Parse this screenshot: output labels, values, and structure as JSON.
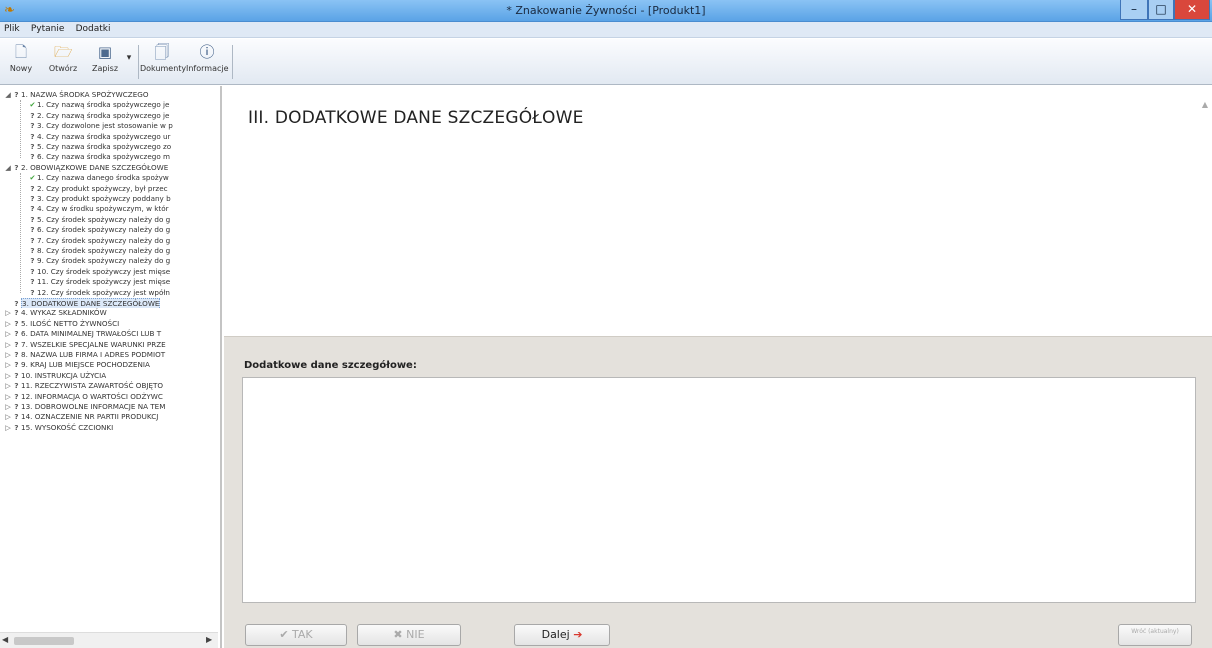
{
  "window": {
    "title": "* Znakowanie Żywności - [Produkt1]",
    "app_icon": "food-labeling-app-icon",
    "minimize": "–",
    "maximize": "□",
    "close": "✕"
  },
  "menu": [
    "Plik",
    "Pytanie",
    "Dodatki"
  ],
  "toolbar": {
    "new": {
      "label": "Nowy",
      "icon": "new-document-icon"
    },
    "open": {
      "label": "Otwórz",
      "icon": "open-folder-icon"
    },
    "save": {
      "label": "Zapisz",
      "icon": "save-disk-icon"
    },
    "save_dropdown": "▾",
    "documents": {
      "label": "Dokumenty",
      "icon": "documents-icon"
    },
    "info": {
      "label": "Informacje",
      "icon": "info-icon"
    }
  },
  "tree": [
    {
      "label": "1. NAZWA ŚRODKA SPOŻYWCZEGO",
      "expander": "◢",
      "status": "?",
      "children": [
        {
          "label": "1. Czy nazwą środka spożywczego je",
          "status": "✔"
        },
        {
          "label": "2. Czy nazwą środka spożywczego je",
          "status": "?"
        },
        {
          "label": "3. Czy dozwolone jest stosowanie w p",
          "status": "?"
        },
        {
          "label": "4. Czy nazwa środka spożywczego ur",
          "status": "?"
        },
        {
          "label": "5. Czy nazwa środka spożywczego zo",
          "status": "?"
        },
        {
          "label": "6. Czy nazwa środka spożywczego m",
          "status": "?"
        }
      ]
    },
    {
      "label": "2. OBOWIĄZKOWE DANE SZCZEGÓŁOWE",
      "expander": "◢",
      "status": "?",
      "children": [
        {
          "label": "1. Czy nazwa danego środka spożyw",
          "status": "✔"
        },
        {
          "label": "2. Czy produkt spożywczy, był przec",
          "status": "?"
        },
        {
          "label": "3. Czy produkt spożywczy poddany b",
          "status": "?"
        },
        {
          "label": "4. Czy w środku spożywczym, w któr",
          "status": "?"
        },
        {
          "label": "5. Czy środek spożywczy należy do g",
          "status": "?"
        },
        {
          "label": "6. Czy środek spożywczy należy do g",
          "status": "?"
        },
        {
          "label": "7. Czy środek spożywczy należy do g",
          "status": "?"
        },
        {
          "label": "8. Czy środek spożywczy należy do g",
          "status": "?"
        },
        {
          "label": "9. Czy środek spożywczy należy do g",
          "status": "?"
        },
        {
          "label": "10. Czy środek spożywczy jest mięse",
          "status": "?"
        },
        {
          "label": "11. Czy środek spożywczy jest mięse",
          "status": "?"
        },
        {
          "label": "12. Czy środek spożywczy jest wpółn",
          "status": "?"
        }
      ]
    },
    {
      "label": "3. DODATKOWE DANE SZCZEGÓŁOWE",
      "expander": "",
      "status": "?",
      "selected": true
    },
    {
      "label": "4. WYKAZ SKŁADNIKÓW",
      "expander": "▷",
      "status": "?"
    },
    {
      "label": "5. ILOŚĆ NETTO ŻYWNOŚCI",
      "expander": "▷",
      "status": "?"
    },
    {
      "label": "6. DATA MINIMALNEJ TRWAŁOŚCI LUB T",
      "expander": "▷",
      "status": "?"
    },
    {
      "label": "7. WSZELKIE SPECJALNE WARUNKI PRZE",
      "expander": "▷",
      "status": "?"
    },
    {
      "label": "8. NAZWA LUB FIRMA I ADRES PODMIOT",
      "expander": "▷",
      "status": "?"
    },
    {
      "label": "9. KRAJ LUB MIEJSCE POCHODZENIA",
      "expander": "▷",
      "status": "?"
    },
    {
      "label": "10. INSTRUKCJA UŻYCIA",
      "expander": "▷",
      "status": "?"
    },
    {
      "label": "11. RZECZYWISTA ZAWARTOŚĆ OBJĘTO",
      "expander": "▷",
      "status": "?"
    },
    {
      "label": "12. INFORMACJA O WARTOŚCI ODŻYWC",
      "expander": "▷",
      "status": "?"
    },
    {
      "label": "13. DOBROWOLNE INFORMACJE NA TEM",
      "expander": "▷",
      "status": "?"
    },
    {
      "label": "14. OZNACZENIE NR PARTII PRODUKCJ",
      "expander": "▷",
      "status": "?"
    },
    {
      "label": "15. WYSOKOŚĆ CZCIONKI",
      "expander": "▷",
      "status": "?"
    }
  ],
  "tree_scroll": {
    "left": "◀",
    "right": "▶"
  },
  "main": {
    "section_title": "III. DODATKOWE DANE SZCZEGÓŁOWE",
    "scroll_up": "▲",
    "field_label": "Dodatkowe dane szczegółowe:",
    "field_value": ""
  },
  "buttons": {
    "yes": {
      "label": "TAK",
      "icon": "check-icon",
      "glyph": "✔",
      "enabled": false
    },
    "no": {
      "label": "NIE",
      "icon": "cross-icon",
      "glyph": "✖",
      "enabled": false
    },
    "next": {
      "label": "Dalej",
      "icon": "arrow-right-icon",
      "glyph": "➔",
      "enabled": true
    },
    "right": {
      "label": "Wróć (aktualny)",
      "enabled": false
    }
  },
  "colors": {
    "titlebar": "#5aa3e6",
    "close": "#d9473c",
    "panel": "#e4e1dc",
    "check": "#3fa43a",
    "arrow": "#d8392f"
  }
}
